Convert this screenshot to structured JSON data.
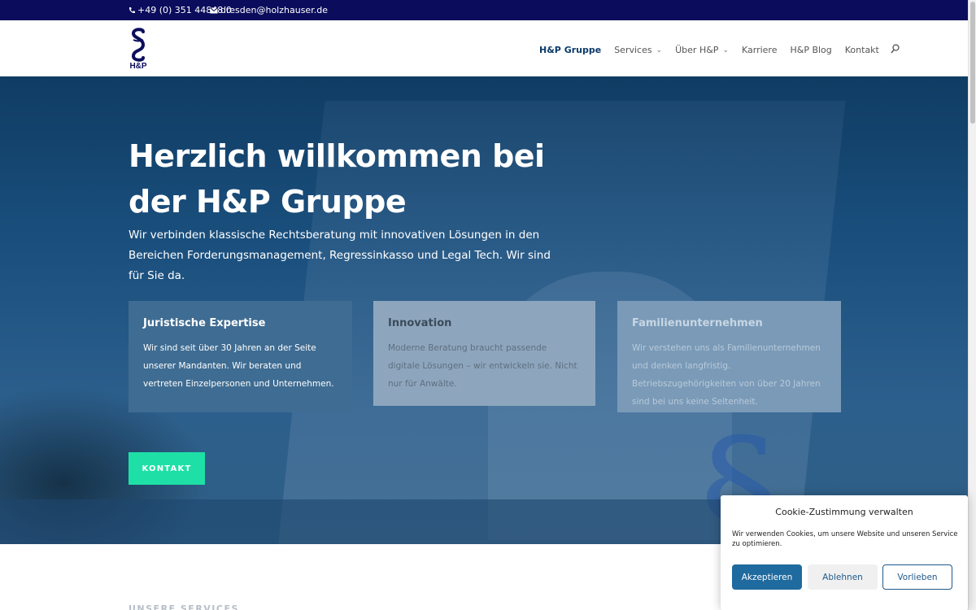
{
  "topbar": {
    "phone": "+49 (0) 351 44848 0",
    "email": "dresden@holzhauser.de",
    "phone_icon": "phone-icon",
    "email_icon": "envelope-icon"
  },
  "header": {
    "logo_text": "H&P",
    "nav": [
      {
        "label": "H&P Gruppe"
      },
      {
        "label": "Services"
      },
      {
        "label": "Über H&P"
      },
      {
        "label": "Karriere"
      },
      {
        "label": "H&P Blog"
      },
      {
        "label": "Kontakt"
      }
    ],
    "search_icon": "search-icon"
  },
  "hero": {
    "title": "Herzlich willkommen bei der H&P Gruppe",
    "lead": "Wir verbinden klassische Rechtsberatung mit innovativen Lösungen in den Bereichen Forderungsmanagement, Regressinkasso und Legal Tech. Wir sind für Sie da.",
    "cards": [
      {
        "title": "Juristische Expertise",
        "text": "Wir sind seit über 30 Jahren an der Seite unserer Mandanten. Wir beraten und vertreten Einzelpersonen und Unternehmen."
      },
      {
        "title": "Innovation",
        "text": "Moderne Beratung braucht passende digitale Lösungen – wir entwickeln sie. Nicht nur für Anwälte."
      },
      {
        "title": "Familienunternehmen",
        "text": "Wir verstehen uns als Familienunternehmen und denken langfristig. Betriebszugehörigkeiten von über 20 Jahren sind bei uns keine Seltenheit."
      }
    ],
    "cta_label": "KONTAKT"
  },
  "services_label": "UNSERE SERVICES",
  "cookie": {
    "title": "Cookie-Zustimmung verwalten",
    "text": "Wir verwenden Cookies, um unsere Website und unseren Service zu optimieren.",
    "accept": "Akzeptieren",
    "deny": "Ablehnen",
    "preferences": "Vorlieben"
  },
  "colors": {
    "topbar": "#0b0d5c",
    "accent": "#1ee0a6",
    "cookie_primary": "#1f6a9e"
  }
}
